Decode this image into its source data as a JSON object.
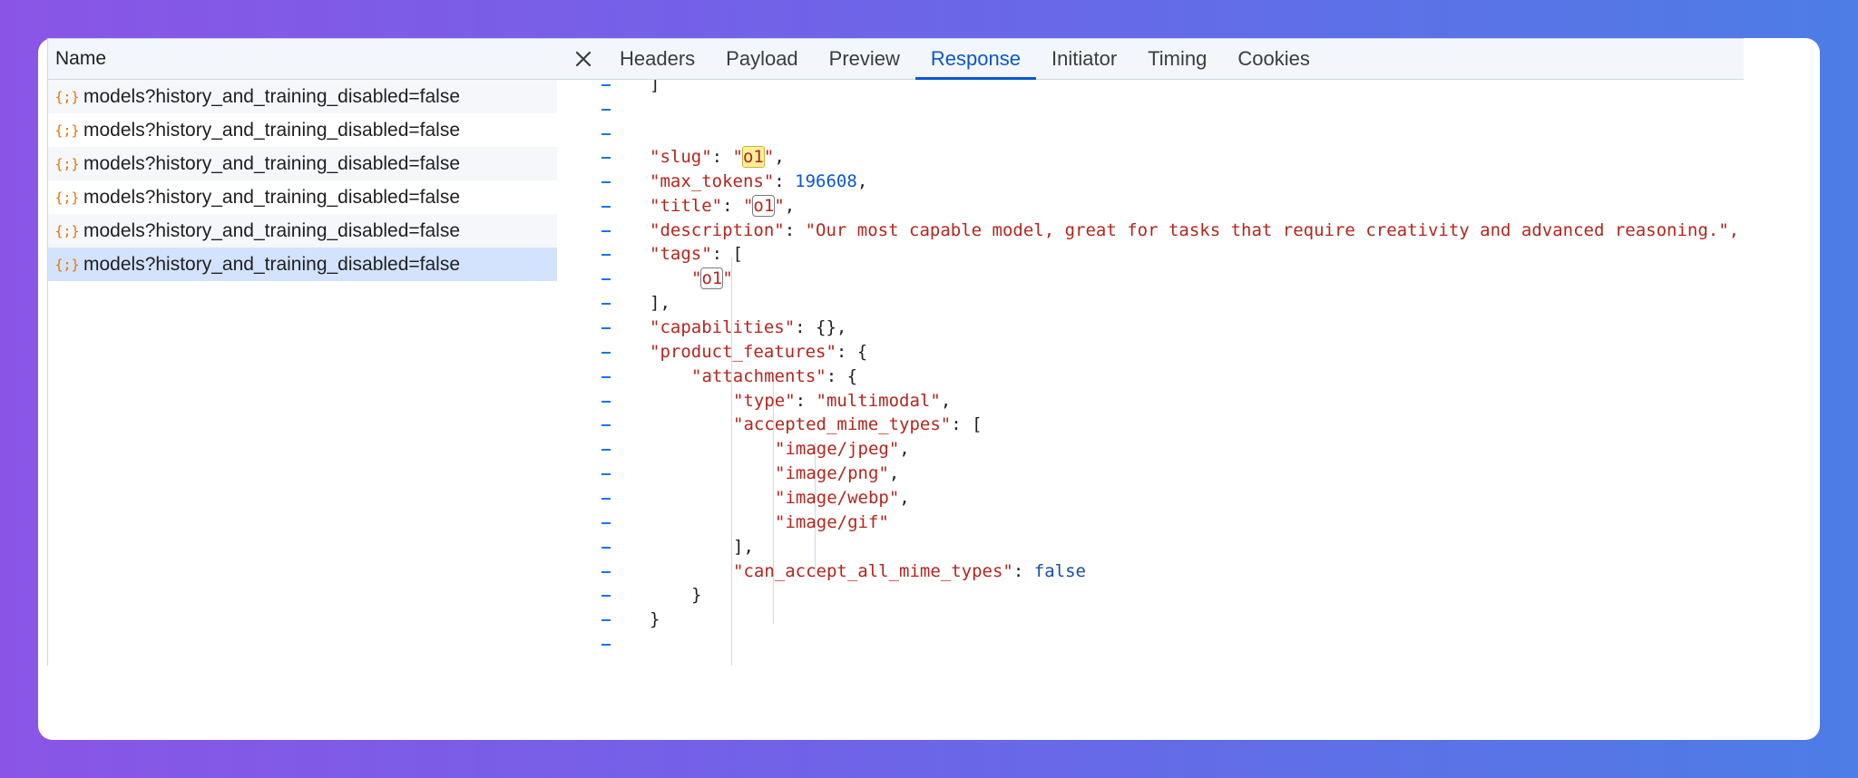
{
  "requests_panel": {
    "header": "Name",
    "rows": [
      {
        "name": "models?history_and_training_disabled=false"
      },
      {
        "name": "models?history_and_training_disabled=false"
      },
      {
        "name": "models?history_and_training_disabled=false"
      },
      {
        "name": "models?history_and_training_disabled=false"
      },
      {
        "name": "models?history_and_training_disabled=false"
      },
      {
        "name": "models?history_and_training_disabled=false",
        "selected": true
      }
    ],
    "row_icon": "json-braces-icon"
  },
  "detail_panel": {
    "close_icon": "close-icon",
    "tabs": [
      {
        "label": "Headers"
      },
      {
        "label": "Payload"
      },
      {
        "label": "Preview"
      },
      {
        "label": "Response",
        "active": true
      },
      {
        "label": "Initiator"
      },
      {
        "label": "Timing"
      },
      {
        "label": "Cookies"
      }
    ]
  },
  "response": {
    "lines": {
      "l0": "]",
      "slug_key": "\"slug\"",
      "slug_val": "o1",
      "max_tokens_key": "\"max_tokens\"",
      "max_tokens_val": "196608",
      "title_key": "\"title\"",
      "title_val": "o1",
      "description_key": "\"description\"",
      "description_val": "\"Our most capable model, great for tasks that require creativity and advanced reasoning.\",",
      "tags_key": "\"tags\"",
      "tags_item": "o1",
      "capabilities_key": "\"capabilities\"",
      "product_features_key": "\"product_features\"",
      "attachments_key": "\"attachments\"",
      "type_key": "\"type\"",
      "type_val": "\"multimodal\"",
      "accepted_key": "\"accepted_mime_types\"",
      "mime1": "\"image/jpeg\"",
      "mime2": "\"image/png\"",
      "mime3": "\"image/webp\"",
      "mime4": "\"image/gif\"",
      "can_accept_key": "\"can_accept_all_mime_types\"",
      "can_accept_val": "false"
    }
  },
  "colors": {
    "accent": "#0b57d0",
    "json_key": "#b3261e",
    "json_number": "#0b57d0",
    "selected_row": "#d3e3fd"
  }
}
